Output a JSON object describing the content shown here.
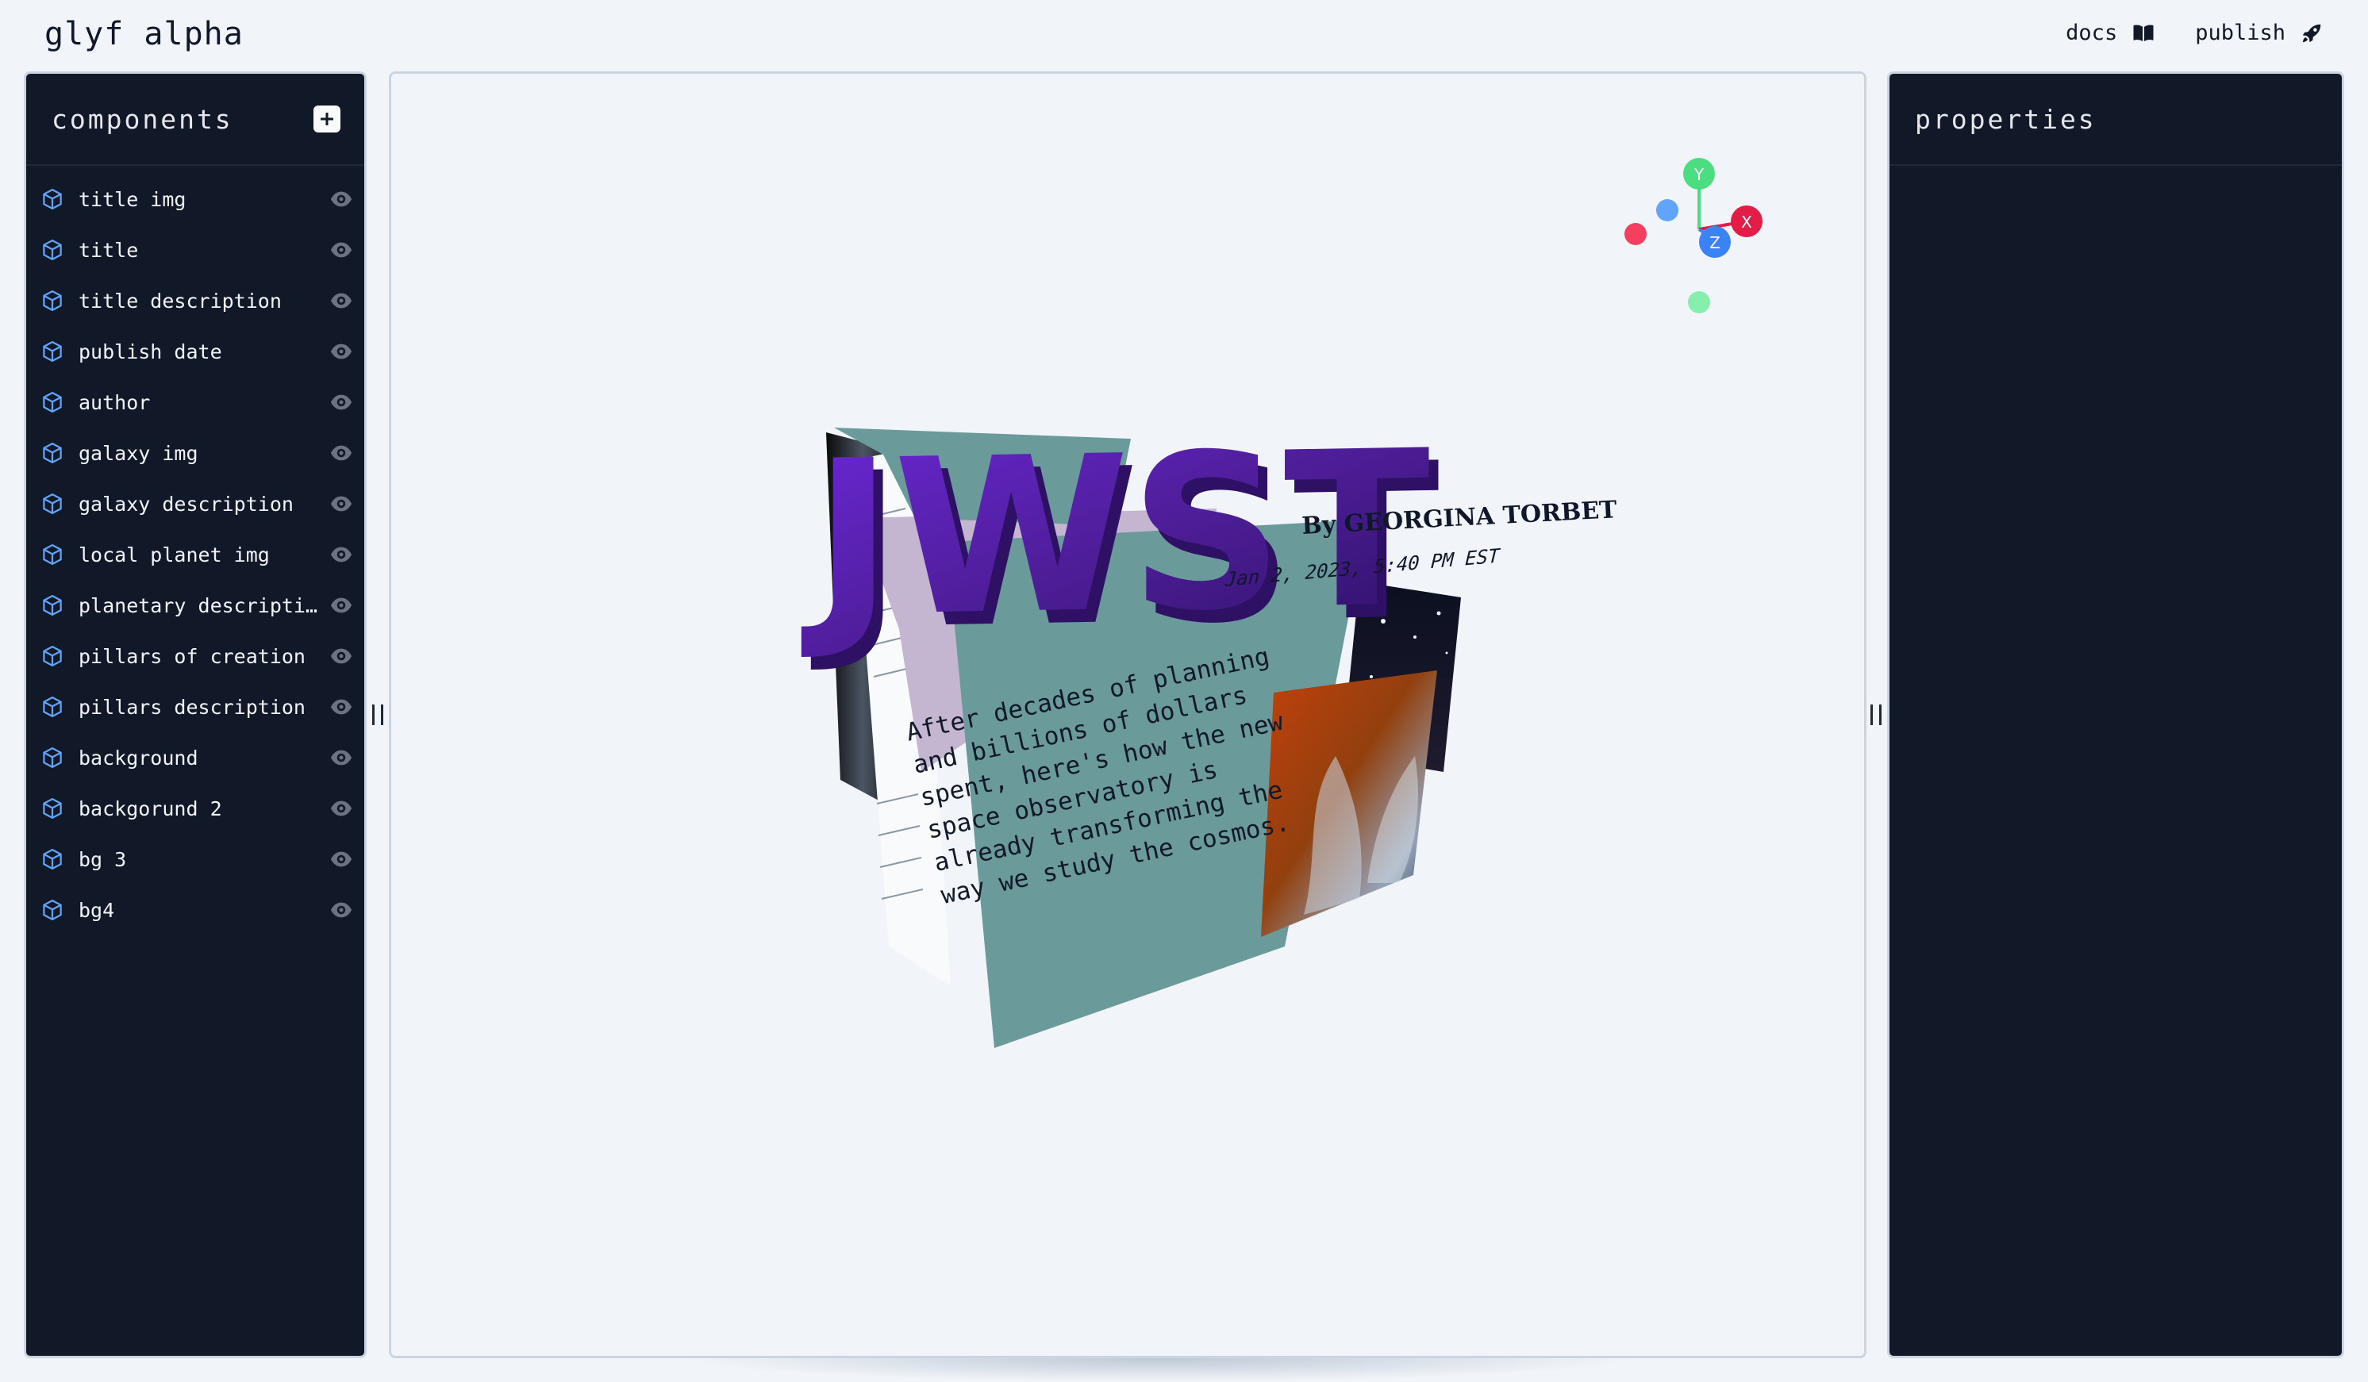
{
  "app": {
    "title": "glyf alpha"
  },
  "header": {
    "docs_label": "docs",
    "publish_label": "publish"
  },
  "components_panel": {
    "title": "components",
    "items": [
      {
        "label": "title img"
      },
      {
        "label": "title"
      },
      {
        "label": "title description"
      },
      {
        "label": "publish date"
      },
      {
        "label": "author"
      },
      {
        "label": "galaxy img"
      },
      {
        "label": "galaxy description"
      },
      {
        "label": "local planet img"
      },
      {
        "label": "planetary descripti…"
      },
      {
        "label": "pillars of creation"
      },
      {
        "label": "pillars description"
      },
      {
        "label": "background"
      },
      {
        "label": "backgorund 2"
      },
      {
        "label": "bg 3"
      },
      {
        "label": "bg4"
      }
    ]
  },
  "properties_panel": {
    "title": "properties"
  },
  "scene": {
    "headline": "JWST",
    "byline": "By GEORGINA TORBET",
    "date": "Jan 2, 2023, 5:40 PM EST",
    "description": [
      "After decades of planning",
      "and billions of dollars",
      "spent, here's how the new",
      "space observatory is",
      "already transforming the",
      "way we study the cosmos."
    ]
  },
  "gizmo": {
    "x_label": "X",
    "y_label": "Y",
    "z_label": "Z"
  },
  "colors": {
    "accent_blue": "#60a5fa",
    "panel_bg": "#111827",
    "headline": "#4c1d95",
    "teal": "#6b9a9a"
  }
}
